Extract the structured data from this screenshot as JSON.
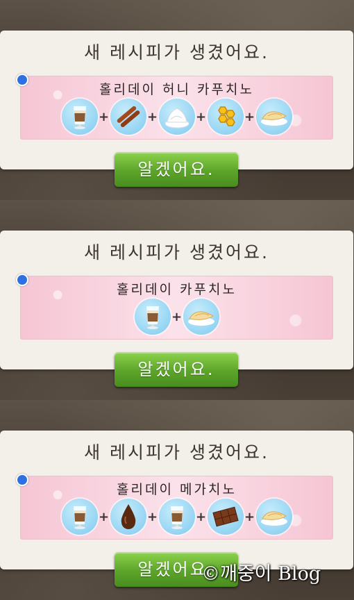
{
  "panels": [
    {
      "title": "새 레시피가 생겼어요.",
      "recipe_name": "홀리데이 카푸치노",
      "ingredients": [
        "latte-glass-icon",
        "fortune-cookie-icon"
      ],
      "button_label": "알겠어요."
    },
    {
      "title": "새 레시피가 생겼어요.",
      "recipe_name": "홀리데이 메가치노",
      "ingredients": [
        "latte-glass-icon",
        "chocolate-syrup-drop-icon",
        "latte-glass-icon",
        "chocolate-bar-icon",
        "fortune-cookie-icon"
      ],
      "button_label": "알겠어요."
    },
    {
      "title": "새 레시피가 생겼어요.",
      "recipe_name": "홀리데이 허니 카푸치노",
      "ingredients": [
        "latte-glass-icon",
        "cinnamon-sticks-icon",
        "whipped-cream-icon",
        "honeycomb-icon",
        "fortune-cookie-icon"
      ],
      "button_label": "알겠어요."
    }
  ],
  "plus_symbol": "+",
  "watermark": "©깨중이 Blog"
}
